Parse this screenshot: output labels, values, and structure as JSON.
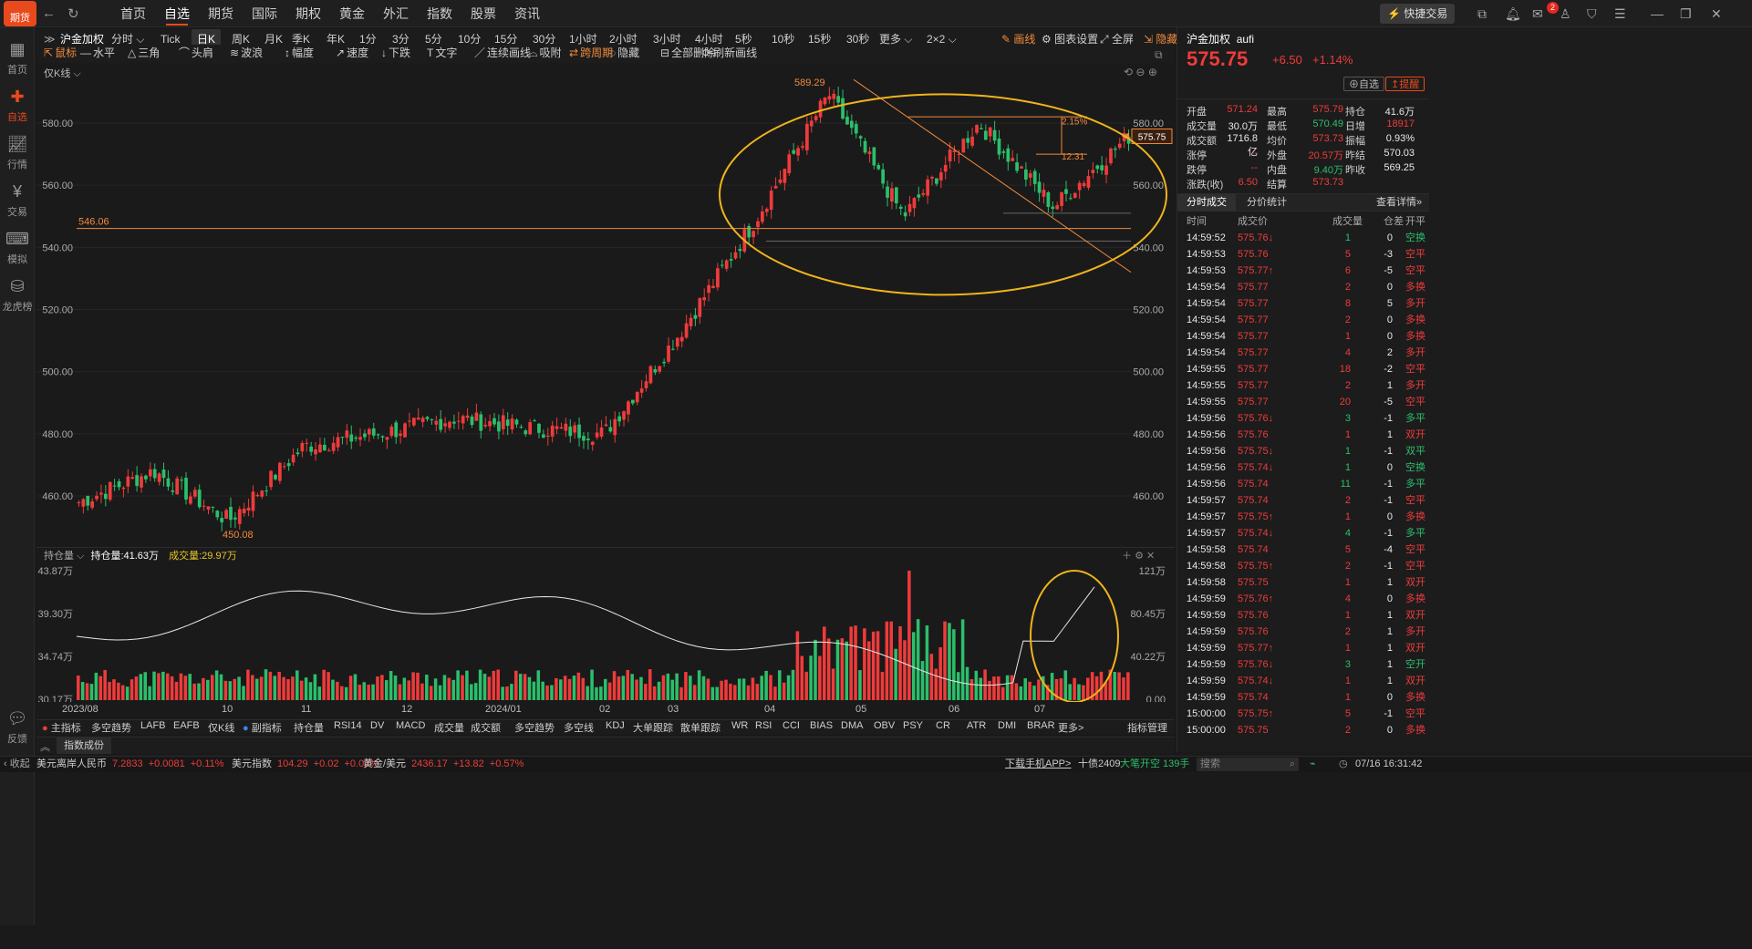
{
  "app": {
    "logo_text": "期货"
  },
  "top_nav": [
    "首页",
    "自选",
    "期货",
    "国际",
    "期权",
    "黄金",
    "外汇",
    "指数",
    "股票",
    "资讯"
  ],
  "top_nav_active": 1,
  "top_right": {
    "quick_trade": "快捷交易",
    "message_badge": "2"
  },
  "sidebar": [
    {
      "label": "首页",
      "icon": "grid-icon"
    },
    {
      "label": "自选",
      "icon": "plus-icon"
    },
    {
      "label": "行情",
      "icon": "chart-icon"
    },
    {
      "label": "交易",
      "icon": "yen-icon"
    },
    {
      "label": "模拟",
      "icon": "gamepad-icon"
    },
    {
      "label": "龙虎榜",
      "icon": "database-icon"
    },
    {
      "label": "反馈",
      "icon": "chat-icon"
    }
  ],
  "sidebar_active": 1,
  "toolbar1": {
    "symbol": "沪金加权",
    "periods": [
      "分时",
      "Tick",
      "日K",
      "周K",
      "月K",
      "季K",
      "年K",
      "1分",
      "3分",
      "5分",
      "10分",
      "15分",
      "30分",
      "1小时",
      "2小时",
      "3小时",
      "4小时",
      "5秒",
      "10秒",
      "15秒",
      "30秒",
      "更多",
      "2×2"
    ],
    "active_period": "日K",
    "draw": "画线",
    "chart_settings": "图表设置",
    "fullscreen": "全屏",
    "hide": "隐藏"
  },
  "toolbar2": [
    "鼠标",
    "水平",
    "三角",
    "头肩",
    "波浪",
    "幅度",
    "速度",
    "下跌",
    "文字",
    "连续画线",
    "吸附",
    "跨周期",
    "隐藏",
    "全部删除",
    "刷新画线"
  ],
  "kline_label": "仅K线",
  "price_axis": [
    "580.00",
    "560.00",
    "540.00",
    "520.00",
    "500.00",
    "480.00",
    "460.00"
  ],
  "annotations": {
    "high": "589.29",
    "low": "450.08",
    "level": "546.06",
    "pct1": "2.15%",
    "pct2": "12.31",
    "current_price": "575.75"
  },
  "volume_panel": {
    "title": "持仓量",
    "oi_label": "持仓量:41.63万",
    "vol_label": "成交量:29.97万",
    "left_axis": [
      "43.87万",
      "39.30万",
      "34.74万",
      "30.17万"
    ],
    "right_axis": [
      "121万",
      "80.45万",
      "40.22万",
      "0.00"
    ]
  },
  "x_axis": [
    "2023/08",
    "10",
    "11",
    "12",
    "2024/01",
    "02",
    "03",
    "04",
    "05",
    "06",
    "07"
  ],
  "bottom_tabs": [
    "主指标",
    "多空趋势",
    "LAFB",
    "EAFB",
    "仅K线",
    "副指标",
    "持仓量",
    "RSI14",
    "DV",
    "MACD",
    "成交量",
    "成交额",
    "多空趋势",
    "多空线",
    "KDJ",
    "大单跟踪",
    "散单跟踪",
    "WR",
    "RSI",
    "CCI",
    "BIAS",
    "DMA",
    "OBV",
    "PSY",
    "CR",
    "ATR",
    "DMI",
    "BRAR",
    "更多>",
    "指标管理"
  ],
  "index_tab": "指数成份",
  "quote": {
    "name": "沪金加权",
    "code": "aufi",
    "price": "575.75",
    "change": "+6.50",
    "change_pct": "+1.14%",
    "watch": "自选",
    "alert": "提醒",
    "fields": [
      [
        "开盘",
        "571.24",
        "最高",
        "575.79",
        "持仓",
        "41.6万"
      ],
      [
        "成交量",
        "30.0万",
        "最低",
        "570.49",
        "日增",
        "18917"
      ],
      [
        "成交额",
        "1716.8亿",
        "均价",
        "573.73",
        "振幅",
        "0.93%"
      ],
      [
        "涨停",
        "--",
        "外盘",
        "20.57万",
        "昨结",
        "570.03"
      ],
      [
        "跌停",
        "--",
        "内盘",
        "9.40万",
        "昨收",
        "569.25"
      ],
      [
        "涨跌(收)",
        "6.50",
        "结算",
        "573.73",
        "",
        ""
      ]
    ]
  },
  "trade_tabs": [
    "分时成交",
    "分价统计",
    "查看详情"
  ],
  "trade_headers": [
    "时间",
    "成交价",
    "成交量",
    "仓差",
    "开平"
  ],
  "trades": [
    [
      "14:59:52",
      "575.76↓",
      "1",
      "0",
      "空换"
    ],
    [
      "14:59:53",
      "575.76",
      "5",
      "-3",
      "空平"
    ],
    [
      "14:59:53",
      "575.77↑",
      "6",
      "-5",
      "空平"
    ],
    [
      "14:59:54",
      "575.77",
      "2",
      "0",
      "多换"
    ],
    [
      "14:59:54",
      "575.77",
      "8",
      "5",
      "多开"
    ],
    [
      "14:59:54",
      "575.77",
      "2",
      "0",
      "多换"
    ],
    [
      "14:59:54",
      "575.77",
      "1",
      "0",
      "多换"
    ],
    [
      "14:59:54",
      "575.77",
      "4",
      "2",
      "多开"
    ],
    [
      "14:59:55",
      "575.77",
      "18",
      "-2",
      "空平"
    ],
    [
      "14:59:55",
      "575.77",
      "2",
      "1",
      "多开"
    ],
    [
      "14:59:55",
      "575.77",
      "20",
      "-5",
      "空平"
    ],
    [
      "14:59:56",
      "575.76↓",
      "3",
      "-1",
      "多平"
    ],
    [
      "14:59:56",
      "575.76",
      "1",
      "1",
      "双开"
    ],
    [
      "14:59:56",
      "575.75↓",
      "1",
      "-1",
      "双平"
    ],
    [
      "14:59:56",
      "575.74↓",
      "1",
      "0",
      "空换"
    ],
    [
      "14:59:56",
      "575.74",
      "11",
      "-1",
      "多平"
    ],
    [
      "14:59:57",
      "575.74",
      "2",
      "-1",
      "空平"
    ],
    [
      "14:59:57",
      "575.75↑",
      "1",
      "0",
      "多换"
    ],
    [
      "14:59:57",
      "575.74↓",
      "4",
      "-1",
      "多平"
    ],
    [
      "14:59:58",
      "575.74",
      "5",
      "-4",
      "空平"
    ],
    [
      "14:59:58",
      "575.75↑",
      "2",
      "-1",
      "空平"
    ],
    [
      "14:59:58",
      "575.75",
      "1",
      "1",
      "双开"
    ],
    [
      "14:59:59",
      "575.76↑",
      "4",
      "0",
      "多换"
    ],
    [
      "14:59:59",
      "575.76",
      "1",
      "1",
      "双开"
    ],
    [
      "14:59:59",
      "575.76",
      "2",
      "1",
      "多开"
    ],
    [
      "14:59:59",
      "575.77↑",
      "1",
      "1",
      "双开"
    ],
    [
      "14:59:59",
      "575.76↓",
      "3",
      "1",
      "空开"
    ],
    [
      "14:59:59",
      "575.74↓",
      "1",
      "1",
      "双开"
    ],
    [
      "14:59:59",
      "575.74",
      "1",
      "0",
      "多换"
    ],
    [
      "15:00:00",
      "575.75↑",
      "5",
      "-1",
      "空平"
    ],
    [
      "15:00:00",
      "575.75",
      "2",
      "0",
      "多换"
    ]
  ],
  "status_bar": {
    "collapse": "收起",
    "items": [
      {
        "name": "美元离岸人民币",
        "price": "7.2833",
        "chg": "+0.0081",
        "pct": "+0.11%"
      },
      {
        "name": "美元指数",
        "price": "104.29",
        "chg": "+0.02",
        "pct": "+0.02%"
      },
      {
        "name": "黄金/美元",
        "price": "2436.17",
        "chg": "+13.82",
        "pct": "+0.57%"
      }
    ],
    "app_link": "下载手机APP>",
    "ticker": "十债2409",
    "ticker_note": "大笔开空 139手",
    "search": "搜索",
    "datetime": "07/16 16:31:42"
  },
  "colors": {
    "up": "#ef3b3b",
    "down": "#2bbf6b",
    "accent": "#e8491d",
    "highlight": "#f0b41c",
    "trendline": "#f08a3c"
  },
  "chart_data": {
    "type": "candlestick",
    "ylim": [
      445,
      595
    ],
    "series": [
      {
        "date": "2023/08",
        "close": 458
      },
      {
        "date": "2023/09",
        "close": 468
      },
      {
        "date": "2023/10",
        "close": 452
      },
      {
        "date": "2023/10",
        "close": 476
      },
      {
        "date": "2023/11",
        "close": 480
      },
      {
        "date": "2023/12",
        "close": 485
      },
      {
        "date": "2024/01",
        "close": 482
      },
      {
        "date": "2024/02",
        "close": 480
      },
      {
        "date": "2024/03",
        "close": 512
      },
      {
        "date": "2024/04",
        "close": 548
      },
      {
        "date": "2024/04",
        "close": 589.29
      },
      {
        "date": "2024/05",
        "close": 550
      },
      {
        "date": "2024/05",
        "close": 580
      },
      {
        "date": "2024/06",
        "close": 553
      },
      {
        "date": "2024/07",
        "close": 575.75
      }
    ]
  }
}
